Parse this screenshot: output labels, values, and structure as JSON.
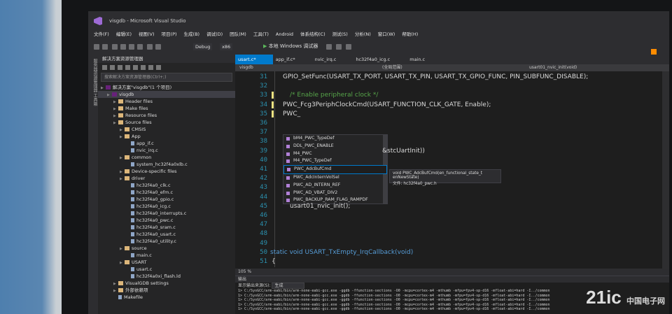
{
  "window": {
    "title": "visgdb - Microsoft Visual Studio"
  },
  "menu": [
    "文件(F)",
    "编辑(E)",
    "视图(V)",
    "项目(P)",
    "生成(B)",
    "调试(D)",
    "团队(M)",
    "工具(T)",
    "Android",
    "体系结构(C)",
    "测试(S)",
    "分析(N)",
    "窗口(W)",
    "帮助(H)"
  ],
  "toolbar": {
    "config": "Debug",
    "platform": "x86",
    "run_label": "本地 Windows 调试器"
  },
  "sidebar_strip": {
    "label": "服务器资源管理器 工具箱"
  },
  "explorer": {
    "title": "解决方案资源管理器",
    "search_placeholder": "搜索解决方案资源管理器(Ctrl+;)",
    "items": [
      {
        "label": "解决方案\"visgdb\"(1 个项目)",
        "indent": 0,
        "type": "sln"
      },
      {
        "label": "visgdb",
        "indent": 1,
        "type": "proj"
      },
      {
        "label": "Header files",
        "indent": 2,
        "type": "folder"
      },
      {
        "label": "Make files",
        "indent": 2,
        "type": "folder"
      },
      {
        "label": "Resource files",
        "indent": 2,
        "type": "folder"
      },
      {
        "label": "Source files",
        "indent": 2,
        "type": "folder"
      },
      {
        "label": "CMSIS",
        "indent": 3,
        "type": "folder"
      },
      {
        "label": "App",
        "indent": 3,
        "type": "folder"
      },
      {
        "label": "app_if.c",
        "indent": 4,
        "type": "file"
      },
      {
        "label": "nvic_irq.c",
        "indent": 4,
        "type": "file"
      },
      {
        "label": "common",
        "indent": 3,
        "type": "folder"
      },
      {
        "label": "system_hc32f4a0xlb.c",
        "indent": 4,
        "type": "file"
      },
      {
        "label": "Device-specific files",
        "indent": 3,
        "type": "folder"
      },
      {
        "label": "driver",
        "indent": 3,
        "type": "folder"
      },
      {
        "label": "hc32f4a0_clk.c",
        "indent": 4,
        "type": "file"
      },
      {
        "label": "hc32f4a0_efm.c",
        "indent": 4,
        "type": "file"
      },
      {
        "label": "hc32f4a0_gpio.c",
        "indent": 4,
        "type": "file"
      },
      {
        "label": "hc32f4a0_icg.c",
        "indent": 4,
        "type": "file"
      },
      {
        "label": "hc32f4a0_interrupts.c",
        "indent": 4,
        "type": "file"
      },
      {
        "label": "hc32f4a0_pwc.c",
        "indent": 4,
        "type": "file"
      },
      {
        "label": "hc32f4a0_sram.c",
        "indent": 4,
        "type": "file"
      },
      {
        "label": "hc32f4a0_usart.c",
        "indent": 4,
        "type": "file"
      },
      {
        "label": "hc32f4a0_utility.c",
        "indent": 4,
        "type": "file"
      },
      {
        "label": "source",
        "indent": 3,
        "type": "folder"
      },
      {
        "label": "main.c",
        "indent": 4,
        "type": "file"
      },
      {
        "label": "USART",
        "indent": 3,
        "type": "folder"
      },
      {
        "label": "usart.c",
        "indent": 4,
        "type": "file"
      },
      {
        "label": "hc32f4a0xi_flash.ld",
        "indent": 4,
        "type": "file"
      },
      {
        "label": "VisualGDB settings",
        "indent": 2,
        "type": "folder"
      },
      {
        "label": "外部依赖项",
        "indent": 2,
        "type": "folder"
      },
      {
        "label": "Makefile",
        "indent": 2,
        "type": "file"
      }
    ]
  },
  "tabs": [
    "usart.c*",
    "app_if.c*",
    "nvic_irq.c",
    "hc32f4a0_icg.c",
    "main.c"
  ],
  "docbar": {
    "project": "visgdb",
    "scope": "(全局范围)",
    "function": "usart01_nvic_init(void)"
  },
  "code_lines": [
    {
      "n": "31",
      "text": "GPIO_SetFunc(USART_TX_PORT, USART_TX_PIN, USART_TX_GPIO_FUNC, PIN_SUBFUNC_DISABLE);"
    },
    {
      "n": "32",
      "text": ""
    },
    {
      "n": "33",
      "text": "/* Enable peripheral clock */"
    },
    {
      "n": "34",
      "text": "PWC_Fcg3PeriphClockCmd(USART_FUNCTION_CLK_GATE, Enable);"
    },
    {
      "n": "35",
      "text": "PWC_"
    },
    {
      "n": "36",
      "text": ""
    },
    {
      "n": "37",
      "text": ""
    },
    {
      "n": "38",
      "text": ""
    },
    {
      "n": "39",
      "text": "&stcUartInit))"
    },
    {
      "n": "40",
      "text": ""
    },
    {
      "n": "41",
      "text": ""
    },
    {
      "n": "42",
      "text": ""
    },
    {
      "n": "43",
      "text": ""
    },
    {
      "n": "44",
      "text": ""
    },
    {
      "n": "45",
      "text": "usart01_nvic_init();"
    },
    {
      "n": "46",
      "text": ""
    },
    {
      "n": "47",
      "text": ""
    },
    {
      "n": "48",
      "text": ""
    },
    {
      "n": "49",
      "text": ""
    },
    {
      "n": "50",
      "text": "static void USART_TxEmpty_IrqCallback(void)"
    },
    {
      "n": "51",
      "text": "{"
    }
  ],
  "autocomplete": {
    "items": [
      "bM4_PWC_TypeDef",
      "DDL_PWC_ENABLE",
      "M4_PWC",
      "M4_PWC_TypeDef",
      "PWC_AdcBufCmd",
      "PWC_AdcInternVolSel",
      "PWC_AD_INTERN_REF",
      "PWC_AD_VBAT_DIV2",
      "PWC_BACKUP_RAM_FLAG_RAMPDF"
    ],
    "selected_index": 4
  },
  "tooltip": {
    "signature": "void PWC_AdcBufCmd(en_functional_state_t enNewState)",
    "file": "文件: hc32f4a0_pwc.h"
  },
  "zoom": "105 %",
  "output": {
    "title": "输出",
    "source_label": "显示输出来源(S):",
    "source_value": "生成",
    "lines": [
      "1>   C:/SysGCC/arm-eabi/bin/arm-none-eabi-gcc.exe -ggdb -ffunction-sections -O0 -mcpu=cortex-m4 -mthumb -mfpu=fpv4-sp-d16 -mfloat-abi=hard -I../common",
      "1>   C:/SysGCC/arm-eabi/bin/arm-none-eabi-gcc.exe -ggdb -ffunction-sections -O0 -mcpu=cortex-m4 -mthumb -mfpu=fpv4-sp-d16 -mfloat-abi=hard -I../common",
      "1>   C:/SysGCC/arm-eabi/bin/arm-none-eabi-gcc.exe -ggdb -ffunction-sections -O0 -mcpu=cortex-m4 -mthumb -mfpu=fpv4-sp-d16 -mfloat-abi=hard -I../common",
      "1>   C:/SysGCC/arm-eabi/bin/arm-none-eabi-gcc.exe -ggdb -ffunction-sections -O0 -mcpu=cortex-m4 -mthumb -mfpu=fpv4-sp-d16 -mfloat-abi=hard -I../common",
      "1>   C:/SysGCC/arm-eabi/bin/arm-none-eabi-gcc.exe -ggdb -ffunction-sections -O0 -mcpu=cortex-m4 -mthumb -mfpu=fpv4-sp-d16 -mfloat-abi=hard -I../common"
    ]
  },
  "watermark": {
    "brand": "21ic",
    "sub": "中国电子网"
  }
}
